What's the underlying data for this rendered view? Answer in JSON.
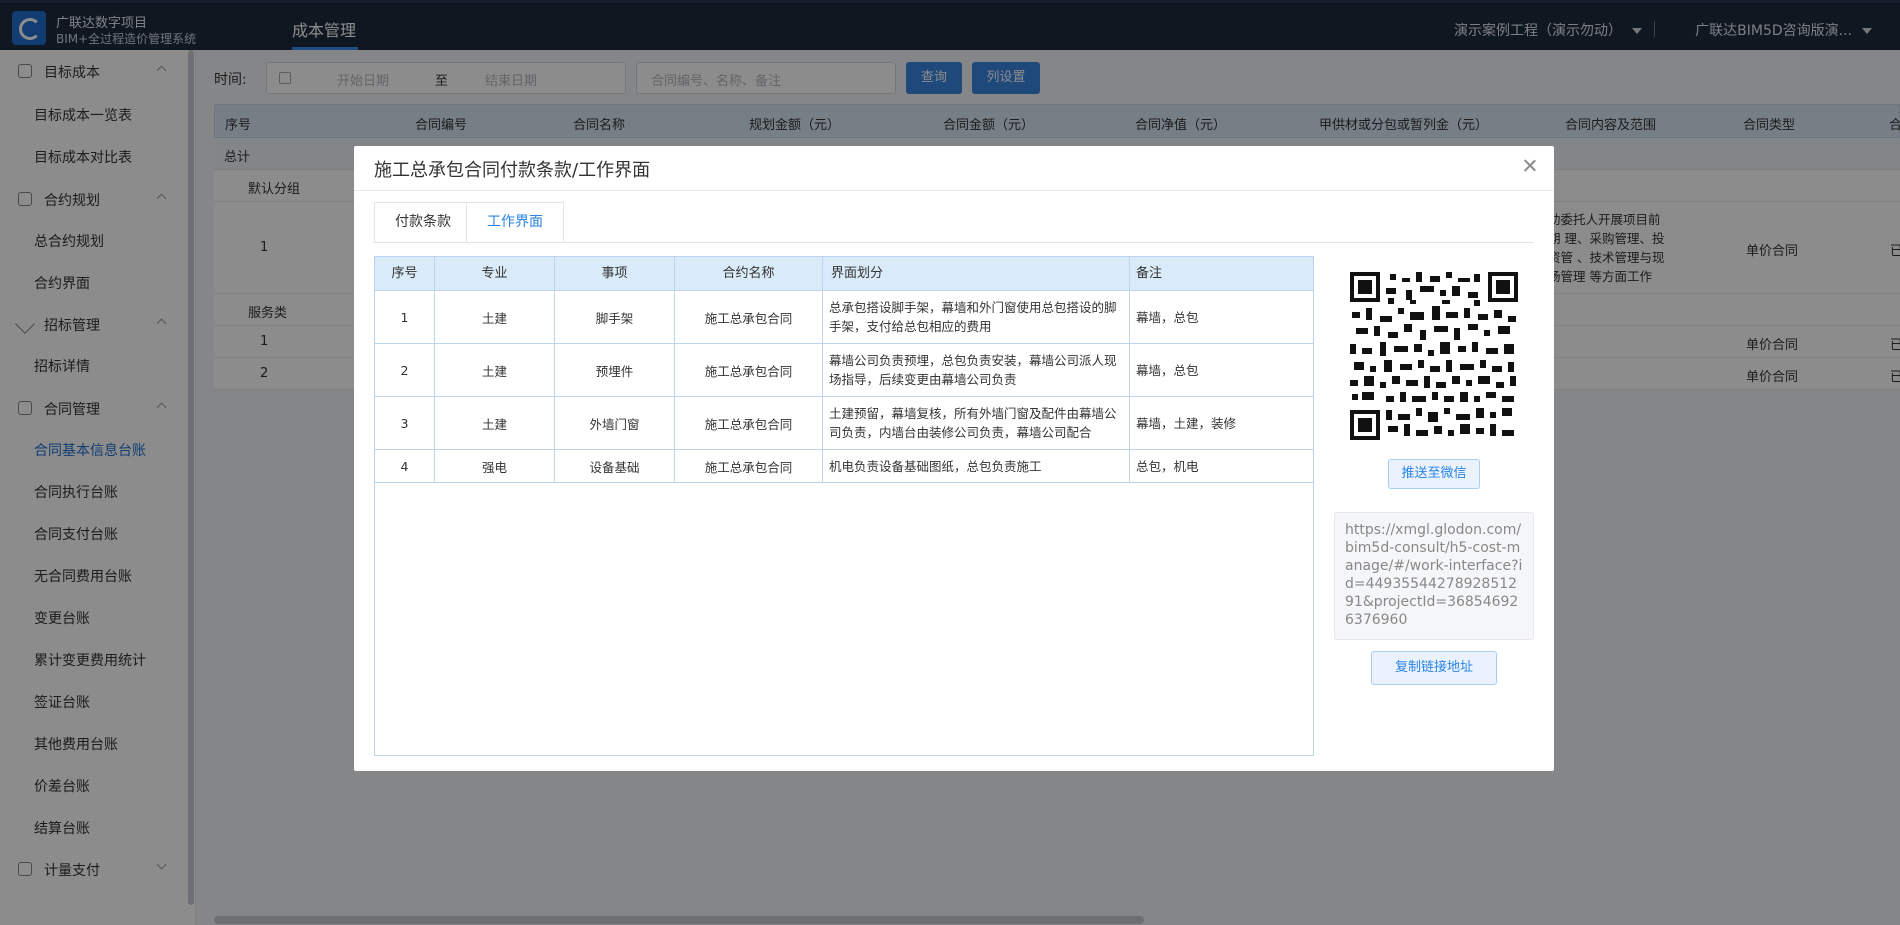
{
  "header": {
    "brand_line1": "广联达数字项目",
    "brand_line2": "BIM+全过程造价管理系统",
    "nav_tab": "成本管理",
    "project_select": "演示案例工程（演示勿动）",
    "org_select": "广联达BIM5D咨询版演..."
  },
  "sidebar": {
    "groups": [
      {
        "label": "目标成本",
        "items": [
          "目标成本一览表",
          "目标成本对比表"
        ]
      },
      {
        "label": "合约规划",
        "items": [
          "总合约规划",
          "合约界面"
        ]
      },
      {
        "label": "招标管理",
        "items": [
          "招标详情"
        ]
      },
      {
        "label": "合同管理",
        "items": [
          "合同基本信息台账",
          "合同执行台账",
          "合同支付台账",
          "无合同费用台账",
          "变更台账",
          "累计变更费用统计",
          "签证台账",
          "其他费用台账",
          "价差台账",
          "结算台账"
        ]
      },
      {
        "label": "计量支付",
        "items": []
      }
    ],
    "active_item": "合同基本信息台账"
  },
  "filters": {
    "time_label": "时间:",
    "start_placeholder": "开始日期",
    "to_text": "至",
    "end_placeholder": "结束日期",
    "search_placeholder": "合同编号、名称、备注",
    "query_button": "查询",
    "columns_button": "列设置"
  },
  "main_table": {
    "headers": [
      "序号",
      "合同编号",
      "合同名称",
      "规划金额（元）",
      "合同金额（元）",
      "合同净值（元）",
      "甲供材或分包或暂列金（元）",
      "合同内容及范围",
      "合同类型",
      "合"
    ],
    "total_label": "总计",
    "group1": "默认分组",
    "group1_row_no": "1",
    "group1_scope": "助委托人开展项目前期 理、采购管理、投资管 、技术管理与现场管理 等方面工作",
    "group1_type": "单价合同",
    "group1_extra": "已",
    "group2": "服务类",
    "group2_rows": [
      {
        "no": "1",
        "type": "单价合同",
        "extra": "已"
      },
      {
        "no": "2",
        "type": "单价合同",
        "extra": "已"
      }
    ]
  },
  "modal": {
    "title": "施工总承包合同付款条款/工作界面",
    "tabs": [
      "付款条款",
      "工作界面"
    ],
    "active_tab": "工作界面",
    "table": {
      "headers": [
        "序号",
        "专业",
        "事项",
        "合约名称",
        "界面划分",
        "备注"
      ],
      "rows": [
        {
          "no": "1",
          "major": "土建",
          "item": "脚手架",
          "contract": "施工总承包合同",
          "division": "总承包搭设脚手架，幕墙和外门窗使用总包搭设的脚手架，支付给总包相应的费用",
          "note": "幕墙，总包"
        },
        {
          "no": "2",
          "major": "土建",
          "item": "预埋件",
          "contract": "施工总承包合同",
          "division": "幕墙公司负责预埋，总包负责安装，幕墙公司派人现场指导，后续变更由幕墙公司负责",
          "note": "幕墙，总包"
        },
        {
          "no": "3",
          "major": "土建",
          "item": "外墙门窗",
          "contract": "施工总承包合同",
          "division": "土建预留，幕墙复核，所有外墙门窗及配件由幕墙公司负责，内墙台由装修公司负责，幕墙公司配合",
          "note": "幕墙，土建，装修"
        },
        {
          "no": "4",
          "major": "强电",
          "item": "设备基础",
          "contract": "施工总承包合同",
          "division": "机电负责设备基础图纸，总包负责施工",
          "note": "总包，机电"
        }
      ]
    },
    "push_button": "推送至微信",
    "url": "https://xmgl.glodon.com/bim5d-consult/h5-cost-manage/#/work-interface?id=4493554427892851291&projectId=368546926376960",
    "copy_button": "复制链接地址"
  }
}
